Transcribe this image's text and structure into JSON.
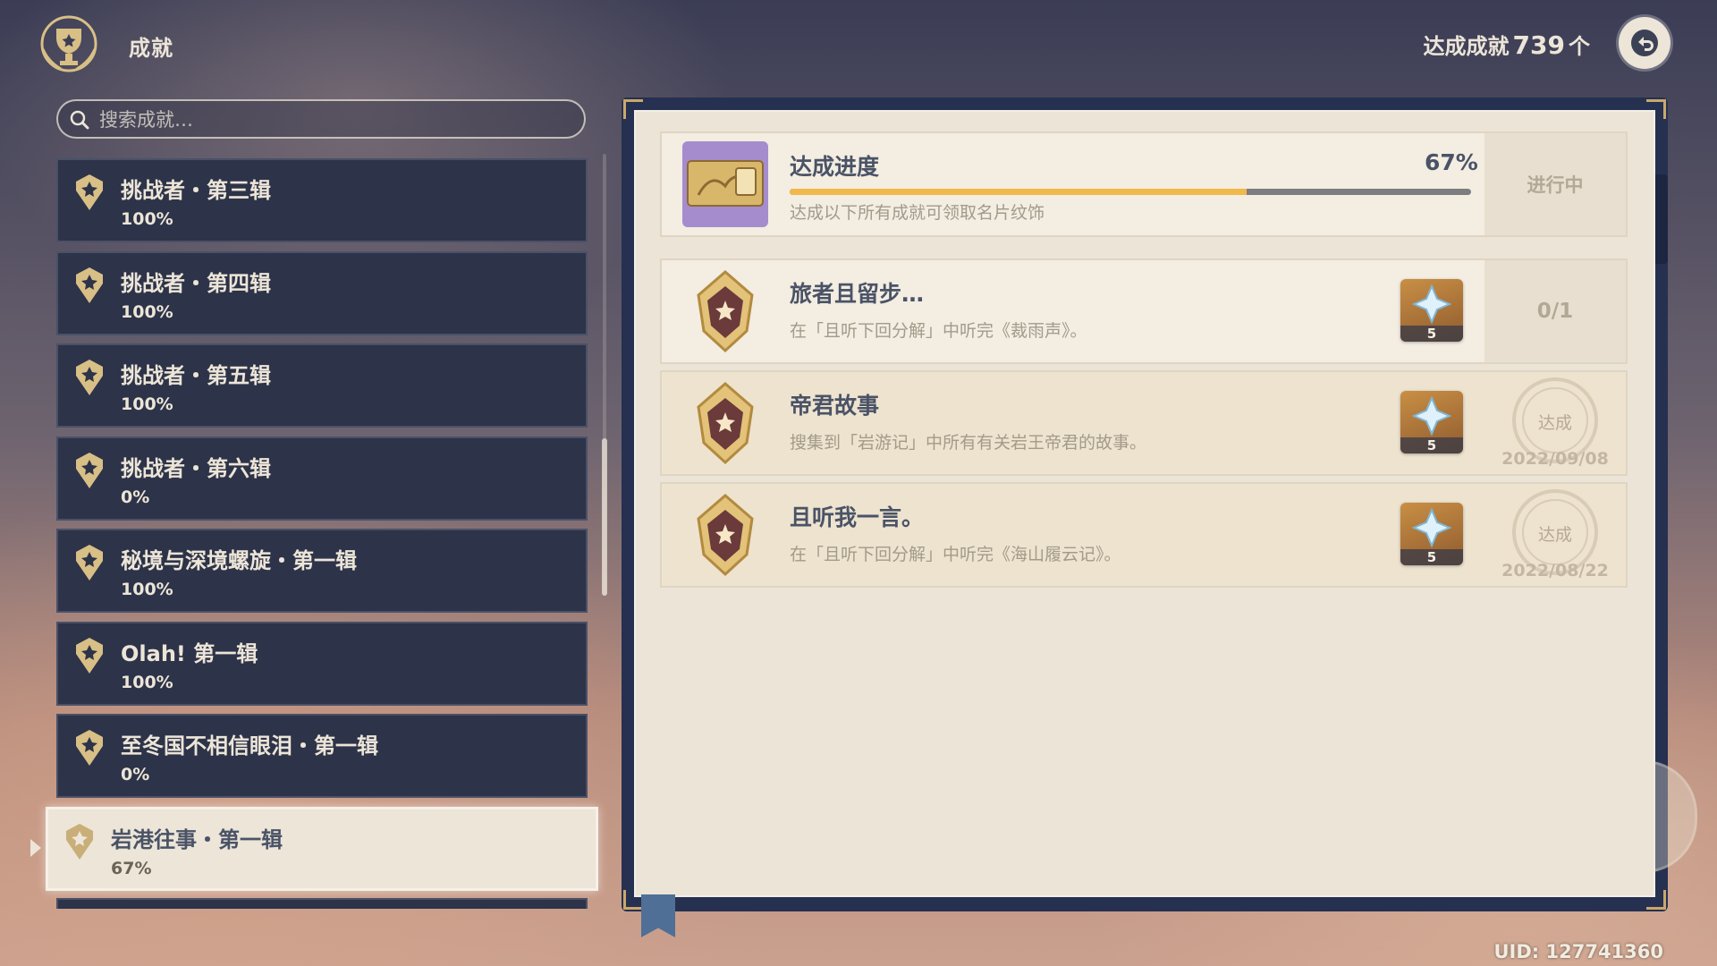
{
  "header": {
    "title": "成就",
    "total_label": "达成成就",
    "total_count": "739",
    "total_unit": "个"
  },
  "search": {
    "placeholder": "搜索成就…"
  },
  "categories": [
    {
      "name": "挑战者・第三辑",
      "percent": "100%"
    },
    {
      "name": "挑战者・第四辑",
      "percent": "100%"
    },
    {
      "name": "挑战者・第五辑",
      "percent": "100%"
    },
    {
      "name": "挑战者・第六辑",
      "percent": "0%"
    },
    {
      "name": "秘境与深境螺旋・第一辑",
      "percent": "100%"
    },
    {
      "name": "Olah! 第一辑",
      "percent": "100%"
    },
    {
      "name": "至冬国不相信眼泪・第一辑",
      "percent": "0%"
    },
    {
      "name": "岩港往事・第一辑",
      "percent": "67%",
      "selected": true
    }
  ],
  "progress": {
    "title": "达成进度",
    "percent_text": "67%",
    "percent_value": 0.67,
    "description": "达成以下所有成就可领取名片纹饰",
    "status": "进行中"
  },
  "achievements": [
    {
      "title": "旅者且留步…",
      "description": "在「且听下回分解」中听完《裁雨声》。",
      "reward_count": "5",
      "status": "0/1",
      "completed": false
    },
    {
      "title": "帝君故事",
      "description": "搜集到「岩游记」中所有有关岩王帝君的故事。",
      "reward_count": "5",
      "status": "达成",
      "date": "2022/09/08",
      "completed": true
    },
    {
      "title": "且听我一言。",
      "description": "在「且听下回分解」中听完《海山履云记》。",
      "reward_count": "5",
      "status": "达成",
      "date": "2022/08/22",
      "completed": true
    }
  ],
  "uid": "UID: 127741360",
  "colors": {
    "accent_gold": "#f0b94a",
    "panel_dark": "#2d3348",
    "paper": "#ebe4d7"
  }
}
